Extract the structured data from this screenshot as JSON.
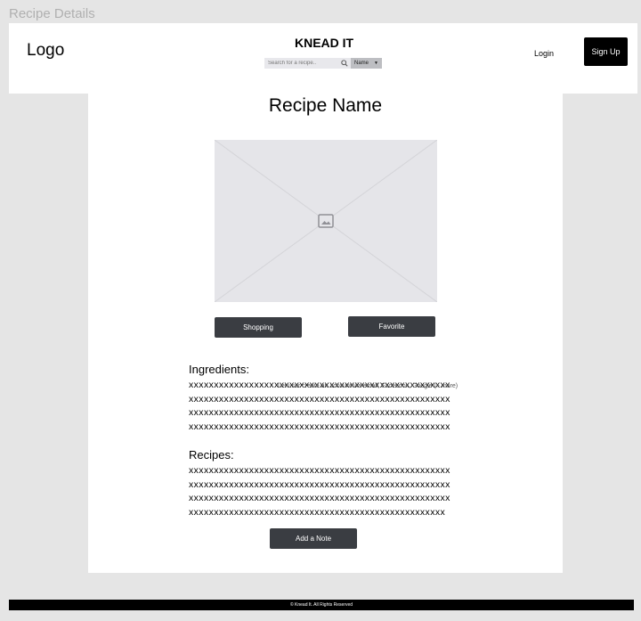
{
  "frame_title": "Recipe Details",
  "header": {
    "logo": "Logo",
    "brand": "KNEAD IT",
    "search": {
      "placeholder": "Search for a recipe..",
      "filter": "Name"
    },
    "login": "Login",
    "signup": "Sign Up"
  },
  "main": {
    "recipe_name": "Recipe Name",
    "shopping_label": "Shopping",
    "favorite_label": "Favorite",
    "ingredients": {
      "heading": "Ingredients:",
      "lines": [
        "xxxxxxxxxxxxxxxxxxxxxxxxxxxxxxxxxxxxxxxxxxxxxxxxxxxx",
        "xxxxxxxxxxxxxxxxxxxxxxxxxxxxxxxxxxxxxxxxxxxxxxxxxxxx",
        "xxxxxxxxxxxxxxxxxxxxxxxxxxxxxxxxxxxxxxxxxxxxxxxxxxxx",
        "xxxxxxxxxxxxxxxxxxxxxxxxxxxxxxxxxxxxxxxxxxxxxxxxxxxx"
      ],
      "overlay_note": "Let user create an account via email, Facebook, Google (+ more)"
    },
    "recipes": {
      "heading": "Recipes:",
      "lines": [
        "xxxxxxxxxxxxxxxxxxxxxxxxxxxxxxxxxxxxxxxxxxxxxxxxxxxx",
        "xxxxxxxxxxxxxxxxxxxxxxxxxxxxxxxxxxxxxxxxxxxxxxxxxxxx",
        "xxxxxxxxxxxxxxxxxxxxxxxxxxxxxxxxxxxxxxxxxxxxxxxxxxxx",
        "xxxxxxxxxxxxxxxxxxxxxxxxxxxxxxxxxxxxxxxxxxxxxxxxxxx"
      ]
    },
    "add_note_label": "Add a Note"
  },
  "footer": "© Knead It. All Rights Reserved"
}
